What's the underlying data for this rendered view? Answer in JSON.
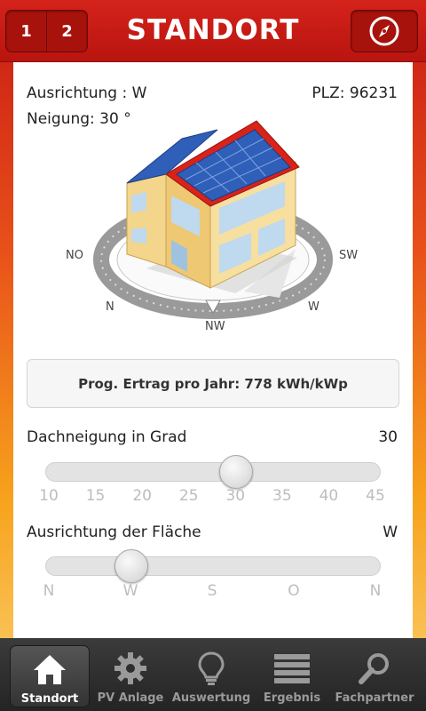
{
  "header": {
    "seg1": "1",
    "seg2": "2",
    "title": "STANDORT"
  },
  "info": {
    "ausrichtung": "Ausrichtung : W",
    "neigung": "Neigung: 30 °",
    "plz": "PLZ: 96231"
  },
  "compass": {
    "no": "NO",
    "sw": "SW",
    "n": "N",
    "w": "W",
    "nw": "NW"
  },
  "yield": {
    "text": "Prog. Ertrag pro Jahr: 778 kWh/kWp"
  },
  "slider_tilt": {
    "label": "Dachneigung in Grad",
    "value": "30",
    "ticks": [
      "10",
      "15",
      "20",
      "25",
      "30",
      "35",
      "40",
      "45"
    ],
    "current": 30,
    "min": 10,
    "max": 45
  },
  "slider_orientation": {
    "label": "Ausrichtung der Fläche",
    "value": "W",
    "ticks": [
      "N",
      "W",
      "S",
      "O",
      "N"
    ],
    "current_index": 1
  },
  "tabs": [
    {
      "label": "Standort",
      "icon": "home-icon",
      "active": true
    },
    {
      "label": "PV Anlage",
      "icon": "gear-icon",
      "active": false
    },
    {
      "label": "Auswertung",
      "icon": "lightbulb-icon",
      "active": false
    },
    {
      "label": "Ergebnis",
      "icon": "list-icon",
      "active": false
    },
    {
      "label": "Fachpartner",
      "icon": "search-icon",
      "active": false
    }
  ],
  "colors": {
    "header_red": "#c81a14",
    "solar_blue": "#2f5fb8",
    "roof_red": "#d9221a",
    "wall_yellow": "#f2d58a"
  }
}
